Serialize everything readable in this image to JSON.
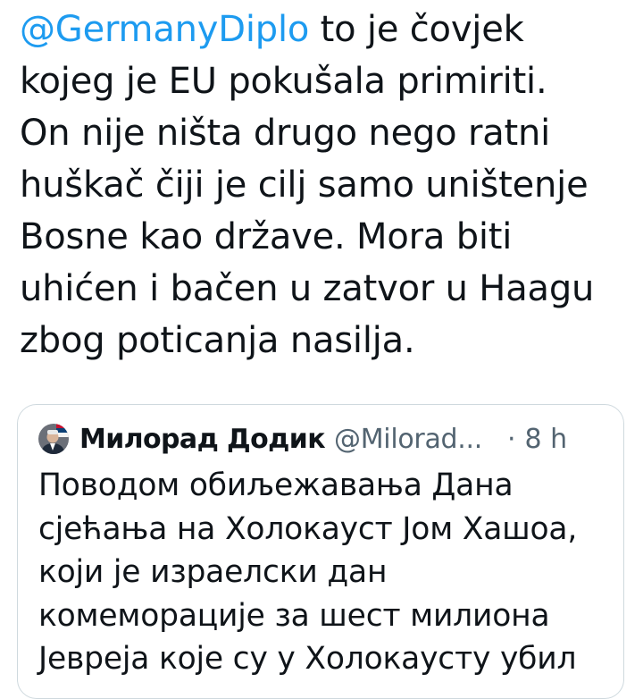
{
  "tweet": {
    "mention": "@GermanyDiplo",
    "lines": [
      " to je čovjek",
      "kojeg je EU pokušala primiriti.",
      "On nije ništa drugo nego ratni",
      "huškač čiji je cilj samo uništenje",
      "Bosne kao države. Mora biti",
      "uhićen i bačen u zatvor u Haagu",
      "zbog poticanja nasilja."
    ]
  },
  "quoted_tweet": {
    "avatar_icon": "avatar-photo-with-flag",
    "author_name": "Милорад Додик",
    "author_handle": "@Milorad...",
    "separator": "·",
    "timestamp": "8 h",
    "lines": [
      "Поводом обиљежавања Дана",
      "сјећања на Холокауст Јом Хашоа,",
      "који је израелски дан",
      "комеморације за шест милиона",
      "Јевреја које су у Холокаусту убил"
    ]
  },
  "colors": {
    "link": "#1d9bf0",
    "text": "#0f1419",
    "secondary_text": "#536471",
    "border": "#cfd9de"
  }
}
